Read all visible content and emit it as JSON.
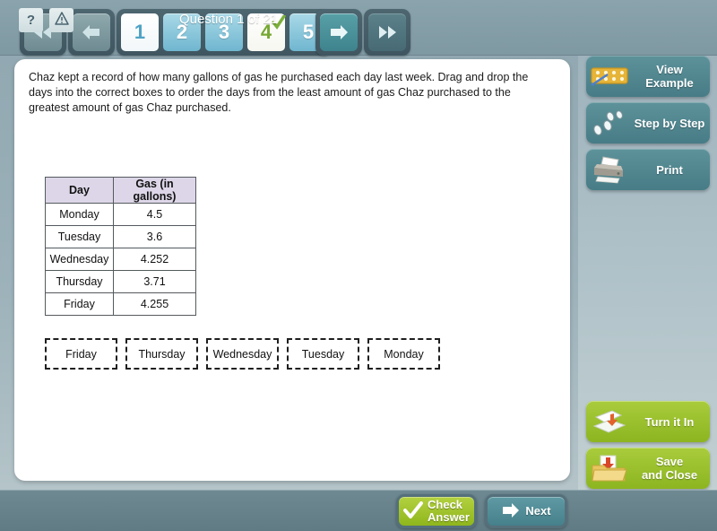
{
  "topbar": {
    "nav": {
      "first_label": "first-page",
      "prev_label": "previous-page",
      "next_label": "next-page",
      "last_label": "last-page"
    },
    "pages": [
      {
        "number": "1",
        "state": "current",
        "completed": false
      },
      {
        "number": "2",
        "state": "normal",
        "completed": false
      },
      {
        "number": "3",
        "state": "normal",
        "completed": false
      },
      {
        "number": "4",
        "state": "done",
        "completed": true
      },
      {
        "number": "5",
        "state": "normal",
        "completed": false
      }
    ]
  },
  "content": {
    "question_text": "Chaz kept a record of how many gallons of gas he purchased each day last week. Drag and drop the days into the correct boxes to order the days from the least amount of gas Chaz purchased to the greatest amount of gas Chaz purchased.",
    "table": {
      "headers": [
        "Day",
        "Gas (in gallons)"
      ],
      "rows": [
        [
          "Monday",
          "4.5"
        ],
        [
          "Tuesday",
          "3.6"
        ],
        [
          "Wednesday",
          "4.252"
        ],
        [
          "Thursday",
          "3.71"
        ],
        [
          "Friday",
          "4.255"
        ]
      ]
    },
    "drop_boxes": [
      "Friday",
      "Thursday",
      "Wednesday",
      "Tuesday",
      "Monday"
    ],
    "tools": [
      {
        "name": "eraser-icon",
        "glyph": ""
      },
      {
        "name": "trash-icon",
        "glyph": ""
      },
      {
        "name": "help-icon",
        "glyph": "?"
      }
    ]
  },
  "sidebar": {
    "buttons": [
      {
        "label": "View\nExample",
        "line1": "View",
        "line2": "Example",
        "icon": "domino-icon",
        "style": "teal"
      },
      {
        "label": "Step by Step",
        "line1": "Step by Step",
        "line2": "",
        "icon": "footprints-icon",
        "style": "teal"
      },
      {
        "label": "Print",
        "line1": "Print",
        "line2": "",
        "icon": "printer-icon",
        "style": "teal"
      },
      {
        "label": "Turn it In",
        "line1": "Turn it In",
        "line2": "",
        "icon": "inbox-tray-icon",
        "style": "green"
      },
      {
        "label": "Save\nand Close",
        "line1": "Save",
        "line2": "and Close",
        "icon": "save-folder-icon",
        "style": "green"
      }
    ]
  },
  "bottombar": {
    "help_glyph": "?",
    "alert_glyph": "",
    "question_counter": "Question 1 of 21",
    "check_answer_line1": "Check",
    "check_answer_line2": "Answer",
    "next_label": "Next"
  },
  "colors": {
    "teal_button": "#5d929a",
    "green_button": "#a9cc3c",
    "page_active": "#4fa3c4",
    "page_done": "#76a832",
    "table_header": "#ddd6e8"
  }
}
